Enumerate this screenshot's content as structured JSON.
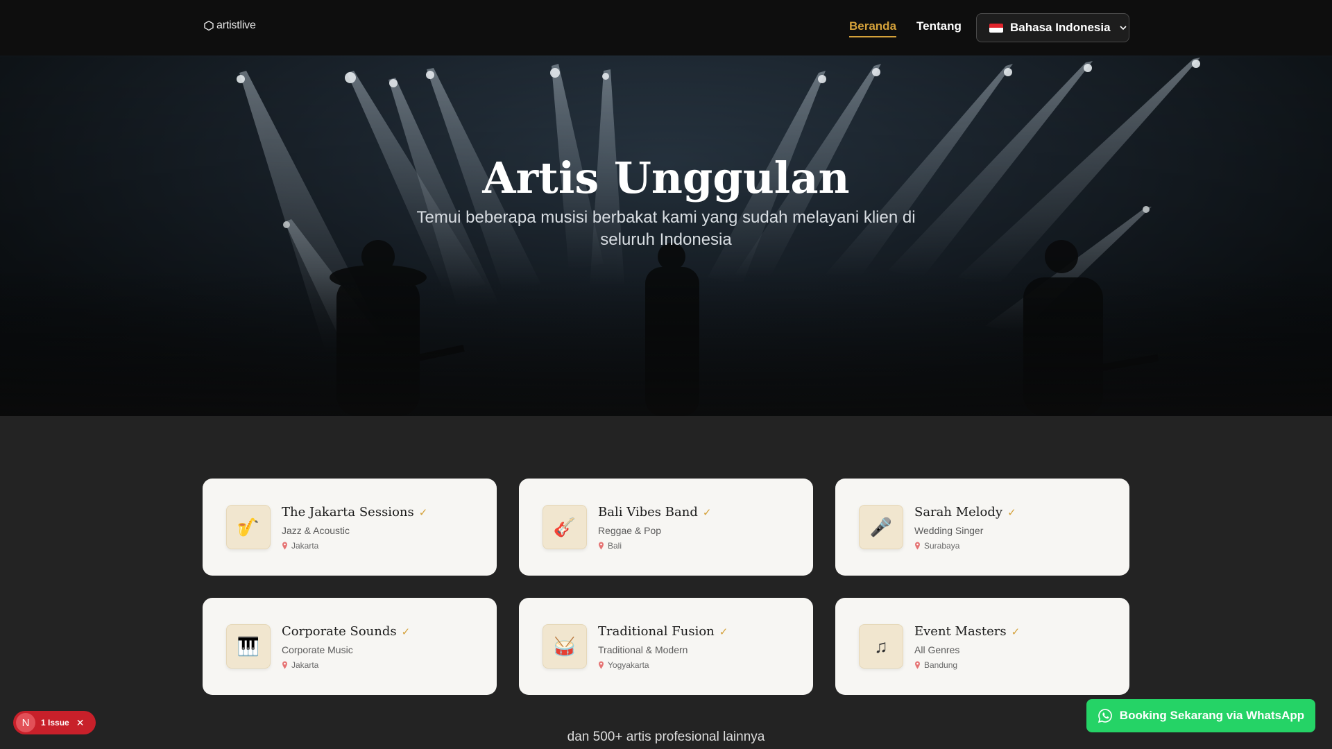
{
  "nav": {
    "logo": "artistlive",
    "links": [
      {
        "label": "Beranda",
        "active": true
      },
      {
        "label": "Tentang",
        "active": false
      }
    ],
    "language": {
      "label": "Bahasa Indonesia",
      "icon": "indonesia-flag-icon"
    }
  },
  "hero": {
    "title": "Artis Unggulan",
    "subtitle": "Temui beberapa musisi berbakat kami yang sudah melayani klien di seluruh Indonesia"
  },
  "artists": [
    {
      "name": "The Jakarta Sessions",
      "genre": "Jazz & Acoustic",
      "location": "Jakarta",
      "icon": "saxophone-icon",
      "emoji": "🎷",
      "verified": true
    },
    {
      "name": "Bali Vibes Band",
      "genre": "Reggae & Pop",
      "location": "Bali",
      "icon": "guitar-icon",
      "emoji": "🎸",
      "verified": true
    },
    {
      "name": "Sarah Melody",
      "genre": "Wedding Singer",
      "location": "Surabaya",
      "icon": "microphone-icon",
      "emoji": "🎤",
      "verified": true
    },
    {
      "name": "Corporate Sounds",
      "genre": "Corporate Music",
      "location": "Jakarta",
      "icon": "piano-icon",
      "emoji": "🎹",
      "verified": true
    },
    {
      "name": "Traditional Fusion",
      "genre": "Traditional & Modern",
      "location": "Yogyakarta",
      "icon": "drum-icon",
      "emoji": "🥁",
      "verified": true
    },
    {
      "name": "Event Masters",
      "genre": "All Genres",
      "location": "Bandung",
      "icon": "music-note-icon",
      "emoji": "♫",
      "verified": true
    }
  ],
  "check_glyph": "✓",
  "more_text": "dan 500+ artis profesional lainnya",
  "issue_badge": {
    "letter": "N",
    "label": "1 Issue"
  },
  "cta": {
    "label": "Booking Sekarang via WhatsApp"
  },
  "colors": {
    "accent": "#d4a13a",
    "whatsapp": "#25d366",
    "issue": "#c8202a",
    "card_bg": "#f7f6f3",
    "page_bg": "#232323"
  }
}
